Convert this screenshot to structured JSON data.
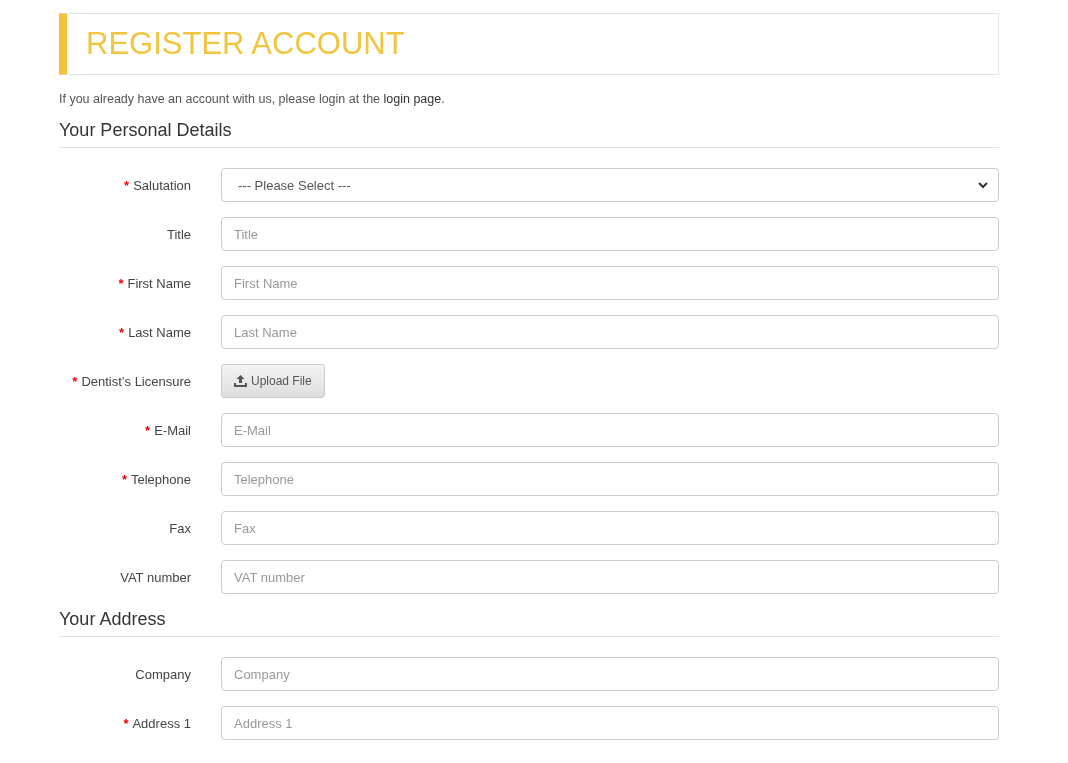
{
  "page_title": "REGISTER ACCOUNT",
  "intro": {
    "text": "If you already have an account with us, please login at the ",
    "link": "login page",
    "after": "."
  },
  "sections": [
    {
      "heading": "Your Personal Details",
      "fields": [
        {
          "kind": "select",
          "label": "Salutation",
          "required_mark": "*",
          "value": "--- Please Select ---"
        },
        {
          "kind": "text",
          "label": "Title",
          "placeholder": "Title"
        },
        {
          "kind": "text",
          "label": "First Name",
          "required_mark": "*",
          "placeholder": "First Name"
        },
        {
          "kind": "text",
          "label": "Last Name",
          "required_mark": "*",
          "placeholder": "Last Name"
        },
        {
          "kind": "file",
          "label": "Dentist’s Licensure",
          "required_mark": "*",
          "button": "Upload File"
        },
        {
          "kind": "text",
          "label": "E-Mail",
          "required_mark": "*",
          "placeholder": "E-Mail"
        },
        {
          "kind": "text",
          "label": "Telephone",
          "required_mark": "*",
          "placeholder": "Telephone"
        },
        {
          "kind": "text",
          "label": "Fax",
          "placeholder": "Fax"
        },
        {
          "kind": "text",
          "label": "VAT number",
          "placeholder": "VAT number"
        }
      ]
    },
    {
      "heading": "Your Address",
      "fields": [
        {
          "kind": "text",
          "label": "Company",
          "placeholder": "Company"
        },
        {
          "kind": "text",
          "label": "Address 1",
          "required_mark": "*",
          "placeholder": "Address 1"
        }
      ]
    }
  ]
}
